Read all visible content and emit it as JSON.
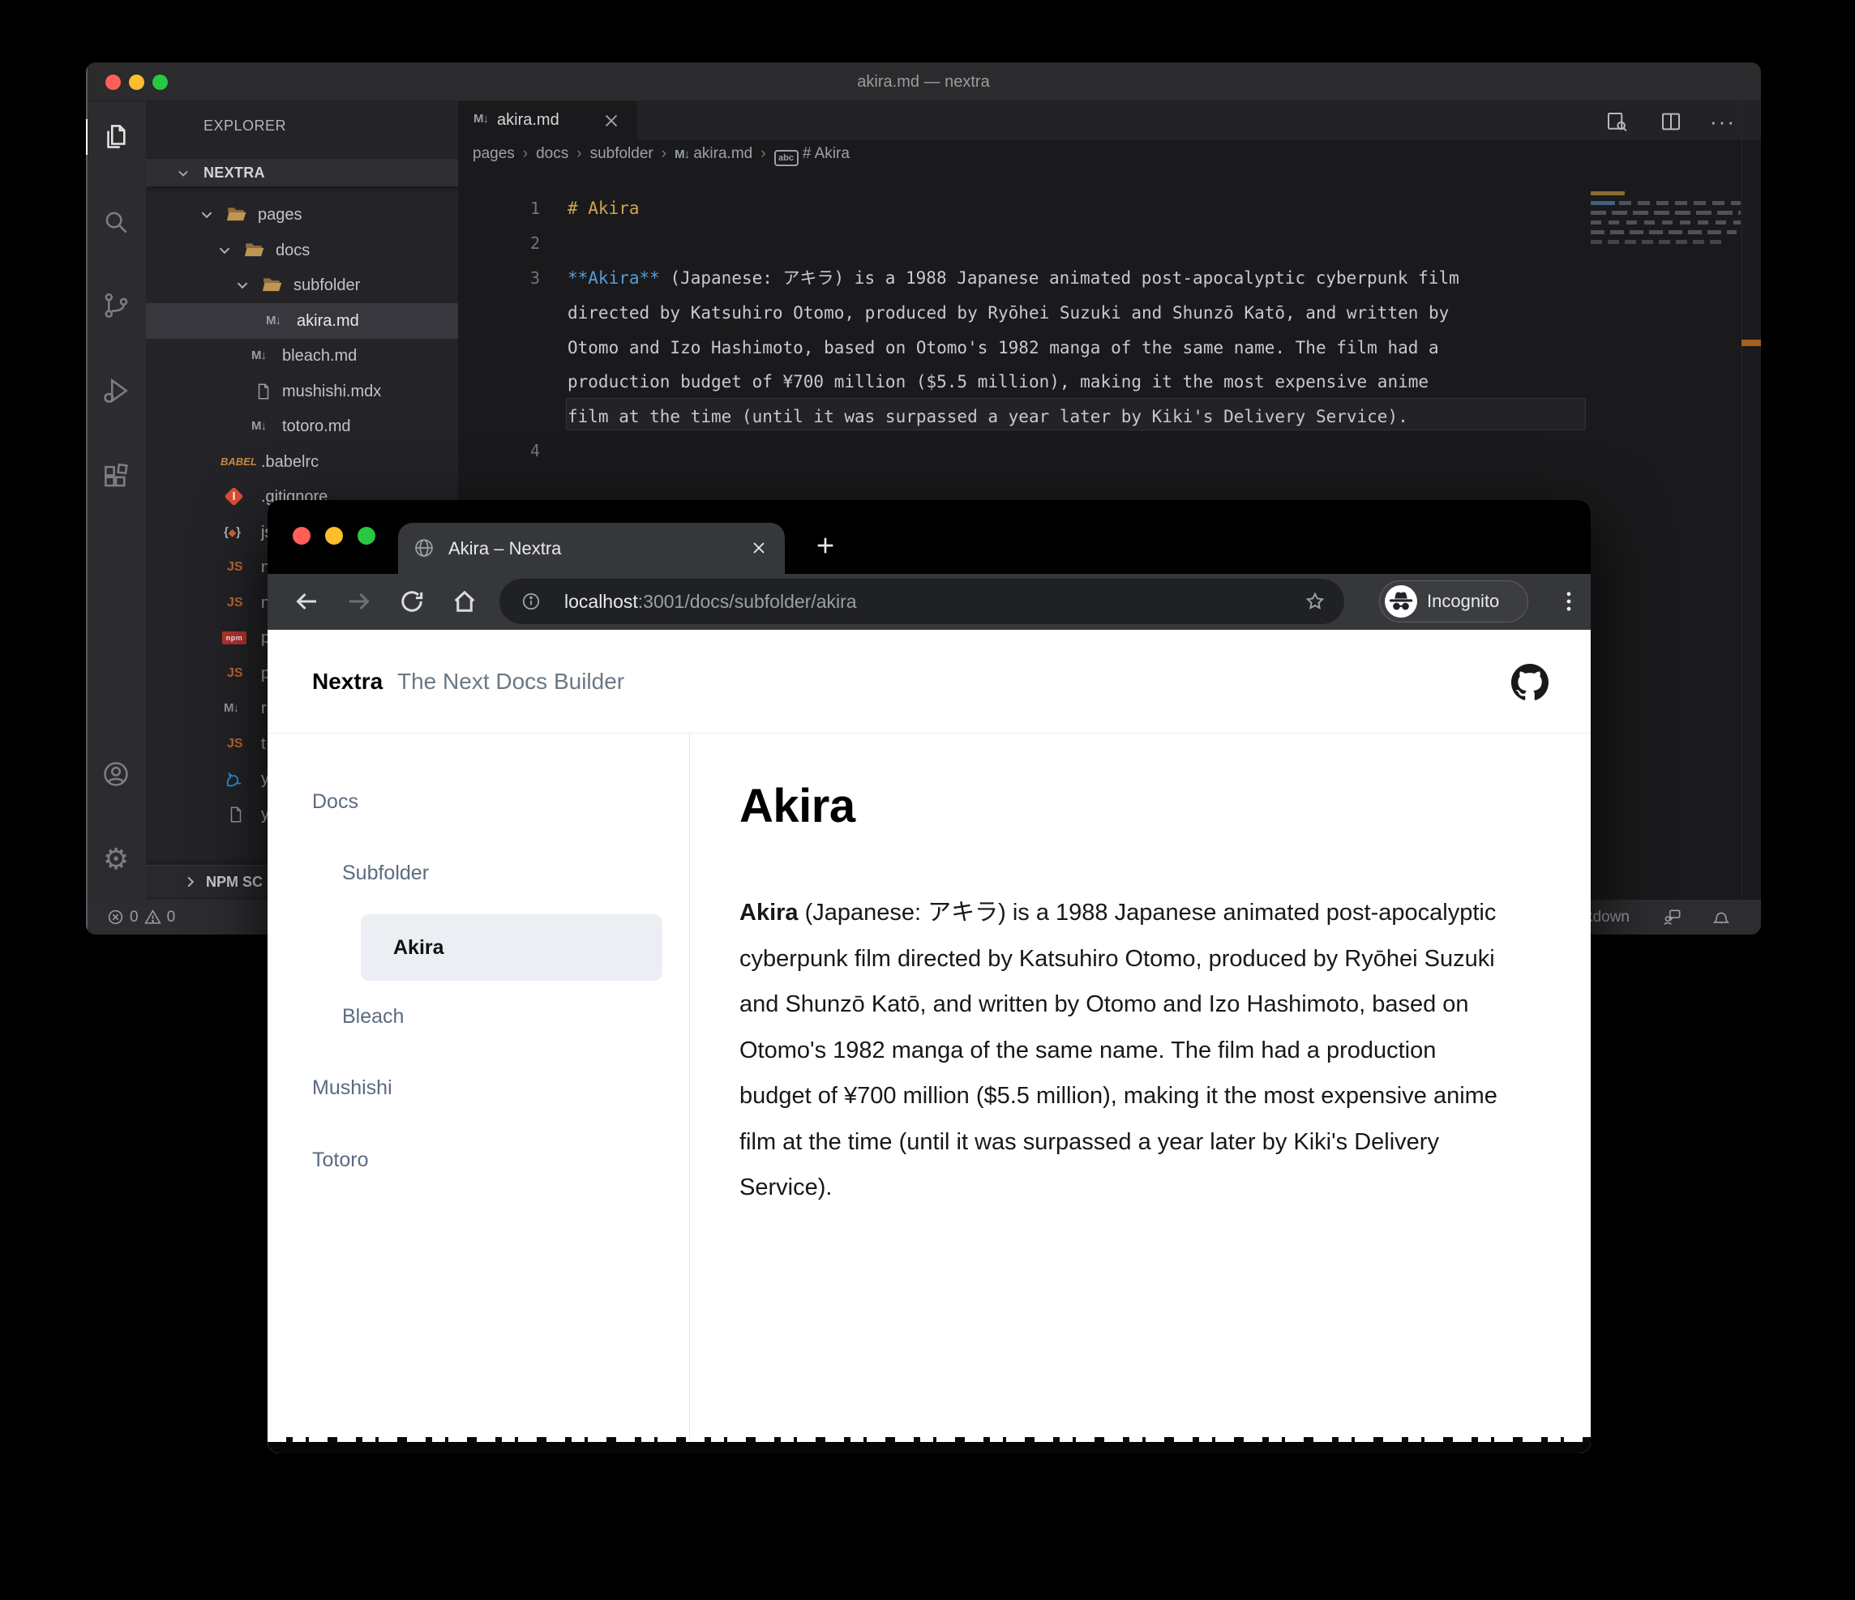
{
  "vscode": {
    "window_title": "akira.md — nextra",
    "explorer": {
      "panel_label": "EXPLORER",
      "section_label": "NEXTRA",
      "npm_section_label": "NPM SC",
      "tree": [
        {
          "label": "pages",
          "icon": "folder-open"
        },
        {
          "label": "docs",
          "icon": "folder-open"
        },
        {
          "label": "subfolder",
          "icon": "folder-open"
        },
        {
          "label": "akira.md",
          "icon": "markdown",
          "selected": true
        },
        {
          "label": "bleach.md",
          "icon": "markdown"
        },
        {
          "label": "mushishi.mdx",
          "icon": "file"
        },
        {
          "label": "totoro.md",
          "icon": "markdown"
        },
        {
          "label": ".babelrc",
          "icon": "babel"
        },
        {
          "label": ".gitignore",
          "icon": "git"
        },
        {
          "label": "js",
          "icon": "json"
        },
        {
          "label": "n",
          "icon": "js"
        },
        {
          "label": "n",
          "icon": "js"
        },
        {
          "label": "p",
          "icon": "npm"
        },
        {
          "label": "p",
          "icon": "js"
        },
        {
          "label": "r",
          "icon": "markdown"
        },
        {
          "label": "t",
          "icon": "js"
        },
        {
          "label": "y",
          "icon": "yarn"
        },
        {
          "label": "y",
          "icon": "file"
        }
      ]
    },
    "editor": {
      "tab_label": "akira.md",
      "breadcrumb": [
        "pages",
        "docs",
        "subfolder",
        "akira.md",
        "# Akira"
      ],
      "code_lines": [
        {
          "num": "1",
          "text": "# Akira"
        },
        {
          "num": "2",
          "text": ""
        },
        {
          "num": "3",
          "bold": "**Akira**",
          "text": " (Japanese: アキラ) is a 1988 Japanese animated post-apocalyptic cyberpunk film"
        },
        {
          "num": "",
          "text": "directed by Katsuhiro Otomo, produced by Ryōhei Suzuki and Shunzō Katō, and written by"
        },
        {
          "num": "",
          "text": "Otomo and Izo Hashimoto, based on Otomo's 1982 manga of the same name. The film had a"
        },
        {
          "num": "",
          "text": "production budget of ¥700 million ($5.5 million), making it the most expensive anime"
        },
        {
          "num": "",
          "text": "film at the time (until it was surpassed a year later by Kiki's Delivery Service)."
        },
        {
          "num": "4",
          "text": ""
        }
      ]
    },
    "status_bar": {
      "errors": "0",
      "warnings": "0",
      "right_text": "kdown"
    }
  },
  "browser": {
    "tab_title": "Akira – Nextra",
    "url": {
      "host": "localhost",
      "path": ":3001/docs/subfolder/akira"
    },
    "incognito_label": "Incognito",
    "page": {
      "brand": "Nextra",
      "tagline": "The Next Docs Builder",
      "sidebar": [
        {
          "label": "Docs"
        },
        {
          "label": "Subfolder"
        },
        {
          "label": "Akira",
          "active": true
        },
        {
          "label": "Bleach"
        },
        {
          "label": "Mushishi"
        },
        {
          "label": "Totoro"
        }
      ],
      "heading": "Akira",
      "paragraph_bold": "Akira",
      "paragraph_rest": " (Japanese: アキラ) is a 1988 Japanese animated post-apocalyptic cyberpunk film directed by Katsuhiro Otomo, produced by Ryōhei Suzuki and Shunzō Katō, and written by Otomo and Izo Hashimoto, based on Otomo's 1982 manga of the same name. The film had a production budget of ¥700 million ($5.5 million), making it the most expensive anime film at the time (until it was surpassed a year later by Kiki's Delivery Service)."
    }
  },
  "colors": {
    "folder_icon": "#C09553",
    "md_heading_token": "#CFA44E",
    "md_bold_token": "#569CD6",
    "tree_selection_bg": "#37373D",
    "browser_chrome_bg": "#36373B",
    "url_bar_bg": "#202124",
    "sidebar_active_bg": "#EBEFF4",
    "sidebar_link": "#5B6B80",
    "overview_ruler_marker": "#A85D20",
    "traffic_red": "#FF5F57",
    "traffic_yellow": "#FEBC2E",
    "traffic_green": "#28C840"
  }
}
